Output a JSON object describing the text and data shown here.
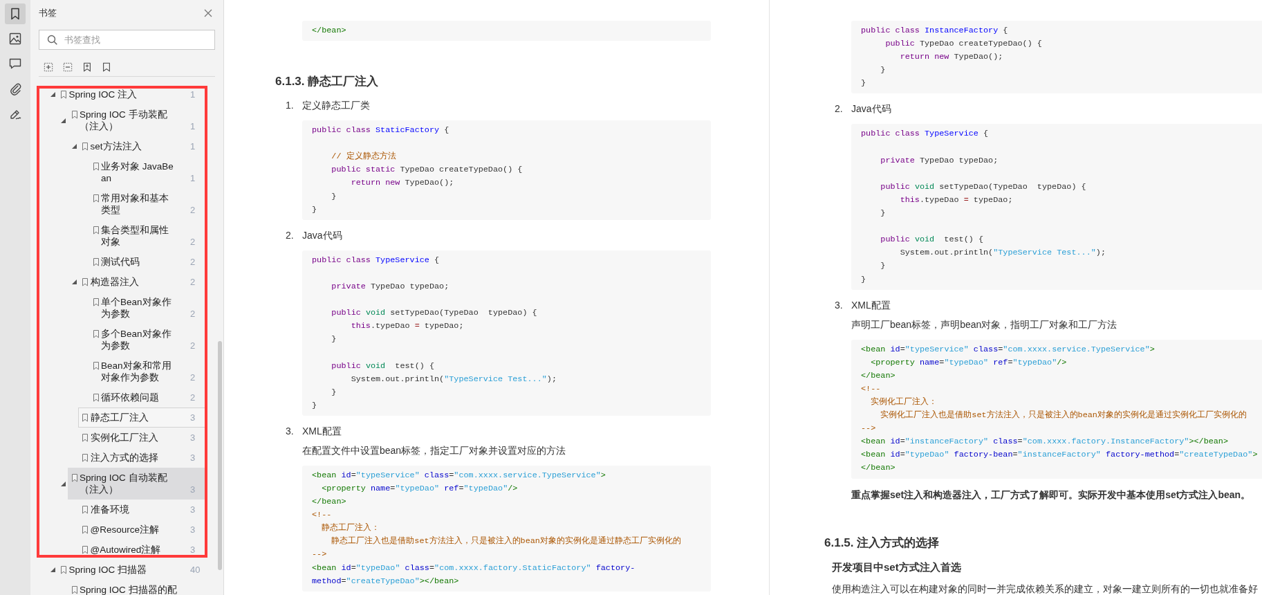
{
  "rail": {
    "icons": [
      {
        "kind": "bookmark",
        "selected": true
      },
      {
        "kind": "image",
        "selected": false
      },
      {
        "kind": "comment",
        "selected": false
      },
      {
        "kind": "attachment",
        "selected": false
      },
      {
        "kind": "signature",
        "selected": false
      }
    ]
  },
  "bookmarks_panel": {
    "title": "书签",
    "search": {
      "placeholder": "书签查找"
    },
    "toolbar": [
      {
        "kind": "expand_all"
      },
      {
        "kind": "collapse_all"
      },
      {
        "kind": "add_bookmark"
      },
      {
        "kind": "bookmark"
      }
    ],
    "tree": [
      {
        "label": "Spring IOC 注入",
        "page": "1",
        "expanded": true,
        "selected": false,
        "focused": false,
        "children": [
          {
            "label": "Spring IOC 手动装配（注入）",
            "page": "1",
            "expanded": true,
            "selected": false,
            "focused": false,
            "children": [
              {
                "label": "set方法注入",
                "page": "1",
                "expanded": true,
                "selected": false,
                "focused": false,
                "children": [
                  {
                    "label": "业务对象 JavaBean",
                    "page": "1",
                    "selected": false,
                    "focused": false
                  },
                  {
                    "label": "常用对象和基本类型",
                    "page": "2",
                    "selected": false,
                    "focused": false
                  },
                  {
                    "label": "集合类型和属性对象",
                    "page": "2",
                    "selected": false,
                    "focused": false
                  },
                  {
                    "label": "测试代码",
                    "page": "2",
                    "selected": false,
                    "focused": false
                  }
                ]
              },
              {
                "label": "构造器注入",
                "page": "2",
                "expanded": true,
                "selected": false,
                "focused": false,
                "children": [
                  {
                    "label": "单个Bean对象作为参数",
                    "page": "2",
                    "selected": false,
                    "focused": false
                  },
                  {
                    "label": "多个Bean对象作为参数",
                    "page": "2",
                    "selected": false,
                    "focused": false
                  },
                  {
                    "label": "Bean对象和常用对象作为参数",
                    "page": "2",
                    "selected": false,
                    "focused": false
                  },
                  {
                    "label": "循环依赖问题",
                    "page": "2",
                    "selected": false,
                    "focused": false
                  }
                ]
              },
              {
                "label": "静态工厂注入",
                "page": "3",
                "selected": false,
                "focused": true
              },
              {
                "label": "实例化工厂注入",
                "page": "3",
                "selected": false,
                "focused": false
              },
              {
                "label": "注入方式的选择",
                "page": "3",
                "selected": false,
                "focused": false
              }
            ]
          },
          {
            "label": "Spring IOC 自动装配（注入）",
            "page": "3",
            "expanded": true,
            "selected": true,
            "focused": false,
            "children": [
              {
                "label": "准备环境",
                "page": "3",
                "selected": false,
                "focused": false
              },
              {
                "label": "@Resource注解",
                "page": "3",
                "selected": false,
                "focused": false
              },
              {
                "label": "@Autowired注解",
                "page": "3",
                "selected": false,
                "focused": false
              }
            ]
          }
        ]
      },
      {
        "label": "Spring IOC 扫描器",
        "page": "40",
        "expanded": true,
        "selected": false,
        "focused": false,
        "children": [
          {
            "label": "Spring IOC 扫描器的配",
            "selected": false,
            "focused": false
          }
        ]
      }
    ]
  },
  "annotation": {
    "kind": "frame"
  },
  "pages": [
    {
      "blocks": [
        {
          "kind": "code",
          "lines": [
            {
              "tokens": [
                {
                  "kind": "tag",
                  "text": "</bean>"
                }
              ]
            }
          ]
        },
        {
          "kind": "heading",
          "text": "6.1.3. 静态工厂注入"
        },
        {
          "kind": "list_item",
          "number": "1.",
          "text": "定义静态工厂类"
        },
        {
          "kind": "code",
          "lines": [
            {
              "blank_before": false,
              "tokens": [
                {
                  "kind": "keyword",
                  "text": "public class"
                },
                {
                  "kind": "def",
                  "text": " StaticFactory"
                },
                {
                  "kind": "plain",
                  "text": " {"
                }
              ]
            },
            {
              "blank_before": true,
              "tokens": [
                {
                  "kind": "comment",
                  "text": "    // 定义静态方法"
                }
              ]
            },
            {
              "blank_before": false,
              "tokens": [
                {
                  "kind": "keyword",
                  "text": "    public static"
                },
                {
                  "kind": "plain",
                  "text": " TypeDao createTypeDao() {"
                }
              ]
            },
            {
              "blank_before": false,
              "tokens": [
                {
                  "kind": "keyword",
                  "text": "        return new"
                },
                {
                  "kind": "plain",
                  "text": " TypeDao();"
                }
              ]
            },
            {
              "blank_before": false,
              "tokens": [
                {
                  "kind": "plain",
                  "text": "    }"
                }
              ]
            },
            {
              "blank_before": false,
              "tokens": [
                {
                  "kind": "plain",
                  "text": "}"
                }
              ]
            }
          ]
        },
        {
          "kind": "list_item",
          "number": "2.",
          "text": "Java代码"
        },
        {
          "kind": "code",
          "lines": [
            {
              "blank_before": false,
              "tokens": [
                {
                  "kind": "keyword",
                  "text": "public class"
                },
                {
                  "kind": "def",
                  "text": " TypeService"
                },
                {
                  "kind": "plain",
                  "text": " {"
                }
              ]
            },
            {
              "blank_before": true,
              "tokens": [
                {
                  "kind": "keyword",
                  "text": "    private"
                },
                {
                  "kind": "plain",
                  "text": " TypeDao typeDao;"
                }
              ]
            },
            {
              "blank_before": true,
              "tokens": [
                {
                  "kind": "keyword",
                  "text": "    public"
                },
                {
                  "kind": "builtin",
                  "text": " void"
                },
                {
                  "kind": "plain",
                  "text": " setTypeDao(TypeDao  typeDao) {"
                }
              ]
            },
            {
              "blank_before": false,
              "tokens": [
                {
                  "kind": "keyword",
                  "text": "        this"
                },
                {
                  "kind": "plain",
                  "text": ".typeDao"
                },
                {
                  "kind": "operator",
                  "text": " ="
                },
                {
                  "kind": "plain",
                  "text": " typeDao;"
                }
              ]
            },
            {
              "blank_before": false,
              "tokens": [
                {
                  "kind": "plain",
                  "text": "    }"
                }
              ]
            },
            {
              "blank_before": true,
              "tokens": [
                {
                  "kind": "keyword",
                  "text": "    public"
                },
                {
                  "kind": "builtin",
                  "text": " void"
                },
                {
                  "kind": "plain",
                  "text": "  test() {"
                }
              ]
            },
            {
              "blank_before": false,
              "tokens": [
                {
                  "kind": "plain",
                  "text": "        System.out.println("
                },
                {
                  "kind": "string",
                  "text": "\"TypeService Test...\""
                },
                {
                  "kind": "plain",
                  "text": ");"
                }
              ]
            },
            {
              "blank_before": false,
              "tokens": [
                {
                  "kind": "plain",
                  "text": "    }"
                }
              ]
            },
            {
              "blank_before": false,
              "tokens": [
                {
                  "kind": "plain",
                  "text": "}"
                }
              ]
            }
          ]
        },
        {
          "kind": "list_item",
          "number": "3.",
          "text": "XML配置"
        },
        {
          "kind": "list_paragraph",
          "text": "在配置文件中设置bean标签，指定工厂对象并设置对应的方法"
        },
        {
          "kind": "code",
          "lines": [
            {
              "tokens": [
                {
                  "kind": "tag",
                  "text": "<bean"
                },
                {
                  "kind": "attribute",
                  "text": " id"
                },
                {
                  "kind": "plain",
                  "text": "="
                },
                {
                  "kind": "string",
                  "text": "\"typeService\""
                },
                {
                  "kind": "attribute",
                  "text": " class"
                },
                {
                  "kind": "plain",
                  "text": "="
                },
                {
                  "kind": "string",
                  "text": "\"com.xxxx.service.TypeService\""
                },
                {
                  "kind": "tag",
                  "text": ">"
                }
              ]
            },
            {
              "tokens": [
                {
                  "kind": "tag",
                  "text": "  <property"
                },
                {
                  "kind": "attribute",
                  "text": " name"
                },
                {
                  "kind": "plain",
                  "text": "="
                },
                {
                  "kind": "string",
                  "text": "\"typeDao\""
                },
                {
                  "kind": "attribute",
                  "text": " ref"
                },
                {
                  "kind": "plain",
                  "text": "="
                },
                {
                  "kind": "string",
                  "text": "\"typeDao\""
                },
                {
                  "kind": "tag",
                  "text": "/>"
                }
              ]
            },
            {
              "tokens": [
                {
                  "kind": "tag",
                  "text": "</bean>"
                }
              ]
            },
            {
              "tokens": [
                {
                  "kind": "comment",
                  "text": "<!--"
                }
              ]
            },
            {
              "tokens": [
                {
                  "kind": "comment",
                  "text": "  静态工厂注入："
                }
              ]
            },
            {
              "tokens": [
                {
                  "kind": "comment",
                  "text": "    静态工厂注入也是借助set方法注入，只是被注入的bean对象的实例化是通过静态工厂实例化的"
                }
              ]
            },
            {
              "tokens": [
                {
                  "kind": "comment",
                  "text": "-->"
                }
              ]
            },
            {
              "tokens": [
                {
                  "kind": "tag",
                  "text": "<bean"
                },
                {
                  "kind": "attribute",
                  "text": " id"
                },
                {
                  "kind": "plain",
                  "text": "="
                },
                {
                  "kind": "string",
                  "text": "\"typeDao\""
                },
                {
                  "kind": "attribute",
                  "text": " class"
                },
                {
                  "kind": "plain",
                  "text": "="
                },
                {
                  "kind": "string",
                  "text": "\"com.xxxx.factory.StaticFactory\""
                },
                {
                  "kind": "attribute",
                  "text": " factory-"
                }
              ]
            },
            {
              "tokens": [
                {
                  "kind": "attribute",
                  "text": "method"
                },
                {
                  "kind": "plain",
                  "text": "="
                },
                {
                  "kind": "string",
                  "text": "\"createTypeDao\""
                },
                {
                  "kind": "tag",
                  "text": "></bean>"
                }
              ]
            }
          ]
        }
      ]
    },
    {
      "blocks": [
        {
          "kind": "code",
          "lines": [
            {
              "tokens": [
                {
                  "kind": "keyword",
                  "text": "public class"
                },
                {
                  "kind": "def",
                  "text": " InstanceFactory"
                },
                {
                  "kind": "plain",
                  "text": " {"
                }
              ]
            },
            {
              "tokens": [
                {
                  "kind": "keyword",
                  "text": "     public"
                },
                {
                  "kind": "plain",
                  "text": " TypeDao createTypeDao() {"
                }
              ]
            },
            {
              "tokens": [
                {
                  "kind": "keyword",
                  "text": "        return new"
                },
                {
                  "kind": "plain",
                  "text": " TypeDao();"
                }
              ]
            },
            {
              "tokens": [
                {
                  "kind": "plain",
                  "text": "    }"
                }
              ]
            },
            {
              "tokens": [
                {
                  "kind": "plain",
                  "text": "}"
                }
              ]
            }
          ]
        },
        {
          "kind": "list_item",
          "number": "2.",
          "text": "Java代码"
        },
        {
          "kind": "code",
          "lines": [
            {
              "blank_before": false,
              "tokens": [
                {
                  "kind": "keyword",
                  "text": "public class"
                },
                {
                  "kind": "def",
                  "text": " TypeService"
                },
                {
                  "kind": "plain",
                  "text": " {"
                }
              ]
            },
            {
              "blank_before": true,
              "tokens": [
                {
                  "kind": "keyword",
                  "text": "    private"
                },
                {
                  "kind": "plain",
                  "text": " TypeDao typeDao;"
                }
              ]
            },
            {
              "blank_before": true,
              "tokens": [
                {
                  "kind": "keyword",
                  "text": "    public"
                },
                {
                  "kind": "builtin",
                  "text": " void"
                },
                {
                  "kind": "plain",
                  "text": " setTypeDao(TypeDao  typeDao) {"
                }
              ]
            },
            {
              "blank_before": false,
              "tokens": [
                {
                  "kind": "keyword",
                  "text": "        this"
                },
                {
                  "kind": "plain",
                  "text": ".typeDao"
                },
                {
                  "kind": "operator",
                  "text": " ="
                },
                {
                  "kind": "plain",
                  "text": " typeDao;"
                }
              ]
            },
            {
              "blank_before": false,
              "tokens": [
                {
                  "kind": "plain",
                  "text": "    }"
                }
              ]
            },
            {
              "blank_before": true,
              "tokens": [
                {
                  "kind": "keyword",
                  "text": "    public"
                },
                {
                  "kind": "builtin",
                  "text": " void"
                },
                {
                  "kind": "plain",
                  "text": "  test() {"
                }
              ]
            },
            {
              "blank_before": false,
              "tokens": [
                {
                  "kind": "plain",
                  "text": "        System.out.println("
                },
                {
                  "kind": "string",
                  "text": "\"TypeService Test...\""
                },
                {
                  "kind": "plain",
                  "text": ");"
                }
              ]
            },
            {
              "blank_before": false,
              "tokens": [
                {
                  "kind": "plain",
                  "text": "    }"
                }
              ]
            },
            {
              "blank_before": false,
              "tokens": [
                {
                  "kind": "plain",
                  "text": "}"
                }
              ]
            }
          ]
        },
        {
          "kind": "list_item",
          "number": "3.",
          "text": "XML配置"
        },
        {
          "kind": "list_paragraph",
          "text": "声明工厂bean标签，声明bean对象，指明工厂对象和工厂方法"
        },
        {
          "kind": "code",
          "lines": [
            {
              "tokens": [
                {
                  "kind": "tag",
                  "text": "<bean"
                },
                {
                  "kind": "attribute",
                  "text": " id"
                },
                {
                  "kind": "plain",
                  "text": "="
                },
                {
                  "kind": "string",
                  "text": "\"typeService\""
                },
                {
                  "kind": "attribute",
                  "text": " class"
                },
                {
                  "kind": "plain",
                  "text": "="
                },
                {
                  "kind": "string",
                  "text": "\"com.xxxx.service.TypeService\""
                },
                {
                  "kind": "tag",
                  "text": ">"
                }
              ]
            },
            {
              "tokens": [
                {
                  "kind": "tag",
                  "text": "  <property"
                },
                {
                  "kind": "attribute",
                  "text": " name"
                },
                {
                  "kind": "plain",
                  "text": "="
                },
                {
                  "kind": "string",
                  "text": "\"typeDao\""
                },
                {
                  "kind": "attribute",
                  "text": " ref"
                },
                {
                  "kind": "plain",
                  "text": "="
                },
                {
                  "kind": "string",
                  "text": "\"typeDao\""
                },
                {
                  "kind": "tag",
                  "text": "/>"
                }
              ]
            },
            {
              "tokens": [
                {
                  "kind": "tag",
                  "text": "</bean>"
                }
              ]
            },
            {
              "tokens": [
                {
                  "kind": "comment",
                  "text": "<!--"
                }
              ]
            },
            {
              "tokens": [
                {
                  "kind": "comment",
                  "text": "  实例化工厂注入："
                }
              ]
            },
            {
              "tokens": [
                {
                  "kind": "comment",
                  "text": "    实例化工厂注入也是借助set方法注入，只是被注入的bean对象的实例化是通过实例化工厂实例化的"
                }
              ]
            },
            {
              "tokens": [
                {
                  "kind": "comment",
                  "text": "-->"
                }
              ]
            },
            {
              "tokens": [
                {
                  "kind": "tag",
                  "text": "<bean"
                },
                {
                  "kind": "attribute",
                  "text": " id"
                },
                {
                  "kind": "plain",
                  "text": "="
                },
                {
                  "kind": "string",
                  "text": "\"instanceFactory\""
                },
                {
                  "kind": "attribute",
                  "text": " class"
                },
                {
                  "kind": "plain",
                  "text": "="
                },
                {
                  "kind": "string",
                  "text": "\"com.xxxx.factory.InstanceFactory\""
                },
                {
                  "kind": "tag",
                  "text": "></bean>"
                }
              ]
            },
            {
              "tokens": [
                {
                  "kind": "tag",
                  "text": "<bean"
                },
                {
                  "kind": "attribute",
                  "text": " id"
                },
                {
                  "kind": "plain",
                  "text": "="
                },
                {
                  "kind": "string",
                  "text": "\"typeDao\""
                },
                {
                  "kind": "attribute",
                  "text": " factory-bean"
                },
                {
                  "kind": "plain",
                  "text": "="
                },
                {
                  "kind": "string",
                  "text": "\"instanceFactory\""
                },
                {
                  "kind": "attribute",
                  "text": " factory-method"
                },
                {
                  "kind": "plain",
                  "text": "="
                },
                {
                  "kind": "string",
                  "text": "\"createTypeDao\""
                },
                {
                  "kind": "tag",
                  "text": ">"
                }
              ]
            },
            {
              "tokens": [
                {
                  "kind": "tag",
                  "text": "</bean>"
                }
              ]
            }
          ]
        },
        {
          "kind": "bold_paragraph",
          "text": "重点掌握set注入和构造器注入，工厂方式了解即可。实际开发中基本使用set方式注入bean。"
        },
        {
          "kind": "heading",
          "text": "6.1.5. 注入方式的选择"
        },
        {
          "kind": "subheading",
          "text": "开发项目中set方式注入首选"
        },
        {
          "kind": "paragraph",
          "text": "使用构造注入可以在构建对象的同时一并完成依赖关系的建立，对象一建立则所有的一切也就准备好"
        }
      ]
    }
  ]
}
